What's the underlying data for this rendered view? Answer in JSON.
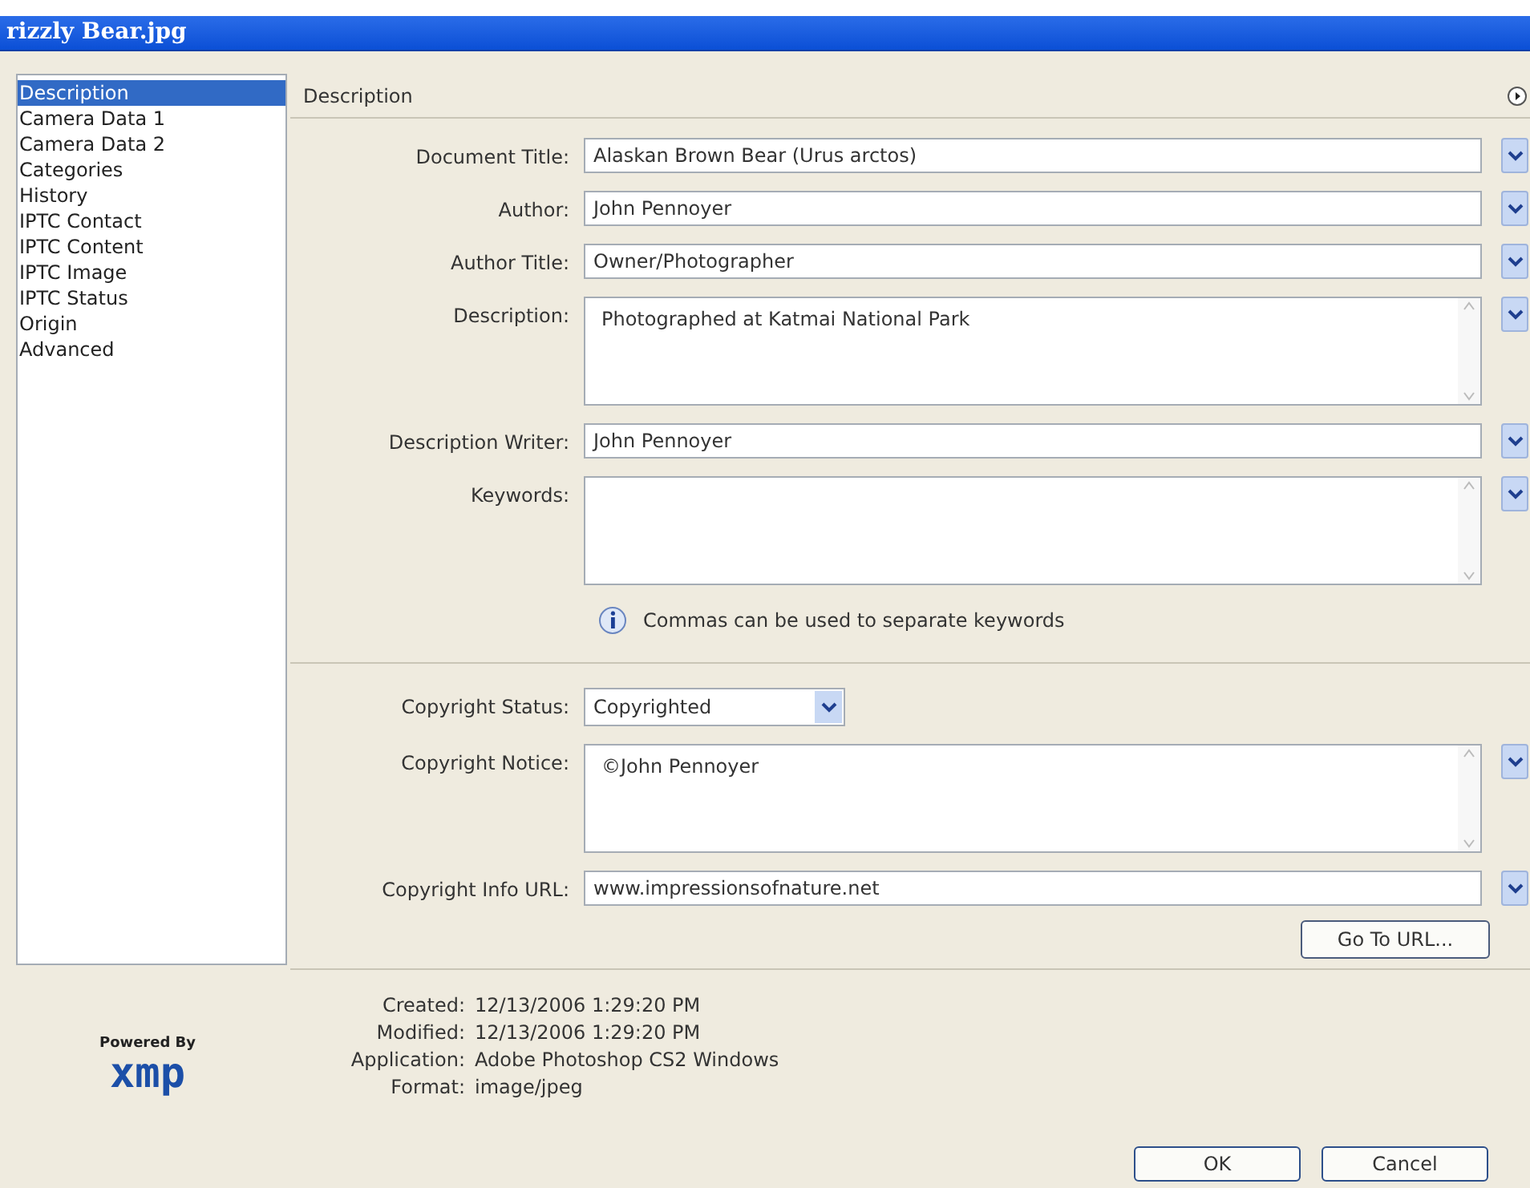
{
  "window": {
    "title": "rizzly Bear.jpg"
  },
  "sidebar": {
    "items": [
      {
        "label": "Description",
        "selected": true
      },
      {
        "label": "Camera Data 1",
        "selected": false
      },
      {
        "label": "Camera Data 2",
        "selected": false
      },
      {
        "label": "Categories",
        "selected": false
      },
      {
        "label": "History",
        "selected": false
      },
      {
        "label": "IPTC Contact",
        "selected": false
      },
      {
        "label": "IPTC Content",
        "selected": false
      },
      {
        "label": "IPTC Image",
        "selected": false
      },
      {
        "label": "IPTC Status",
        "selected": false
      },
      {
        "label": "Origin",
        "selected": false
      },
      {
        "label": "Advanced",
        "selected": false
      }
    ]
  },
  "panel": {
    "title": "Description",
    "fields": [
      {
        "kind": "text",
        "label": "Document Title:",
        "value": "Alaskan Brown Bear (Urus arctos)"
      },
      {
        "kind": "text",
        "label": "Author:",
        "value": "John Pennoyer"
      },
      {
        "kind": "text",
        "label": "Author Title:",
        "value": "Owner/Photographer"
      },
      {
        "kind": "textarea",
        "label": "Description:",
        "value": "Photographed at Katmai National Park"
      },
      {
        "kind": "text",
        "label": "Description Writer:",
        "value": "John Pennoyer"
      },
      {
        "kind": "textarea",
        "label": "Keywords:"
      },
      {
        "kind": "hint",
        "text": "Commas can be used to separate keywords"
      },
      {
        "kind": "divider"
      },
      {
        "kind": "select",
        "label": "Copyright Status:",
        "value": "Copyrighted"
      },
      {
        "kind": "textarea",
        "label": "Copyright Notice:",
        "value": "©John Pennoyer"
      },
      {
        "kind": "text",
        "label": "Copyright Info URL:",
        "value": "www.impressionsofnature.net"
      }
    ],
    "go_button": "Go To URL..."
  },
  "info": [
    {
      "label": "Created:",
      "value": "12/13/2006 1:29:20 PM"
    },
    {
      "label": "Modified:",
      "value": "12/13/2006 1:29:20 PM"
    },
    {
      "label": "Application:",
      "value": "Adobe Photoshop CS2 Windows"
    },
    {
      "label": "Format:",
      "value": "image/jpeg"
    }
  ],
  "logo": {
    "caption": "Powered By",
    "name": "xmp"
  },
  "buttons": [
    "OK",
    "Cancel"
  ]
}
